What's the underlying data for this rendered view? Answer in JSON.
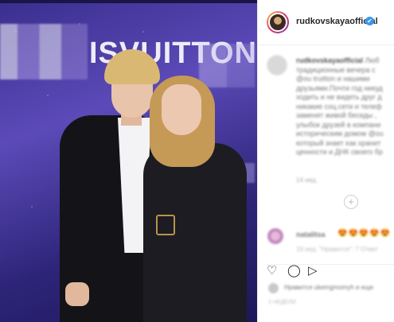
{
  "post": {
    "username": "rudkovskayaofficial",
    "verified_mark": "✔",
    "caption_user": "rudkovskayaofficial",
    "caption_lines": [
      "Люб",
      "традиционные вечера с",
      "@ou truitton и нашими",
      "друзьями.Почти год никуд",
      "ходить и не видеть друг д",
      "никакие соц.сети и телеф",
      "заменят живой беседы ,",
      "улыбок друзей в компани",
      "историческим домом @ou",
      "который знает как хранит",
      "ценности и ДНК своего бр"
    ],
    "time_ago": "14 нед.",
    "load_more_icon": "plus-circle-icon",
    "photo_sign_text": "ISVUITTON"
  },
  "comment": {
    "user": "natalitsa",
    "emojis": "😍😍😍😍😍",
    "meta": "19 нед.   \"Нравится\": 7   Ответ"
  },
  "actions": {
    "like_icon": "♡",
    "comment_icon": "◯",
    "share_icon": "▷"
  },
  "likes": {
    "text": "Нравится ukemgmomyh и еще"
  },
  "date": "2 НЕДЕЛИ"
}
